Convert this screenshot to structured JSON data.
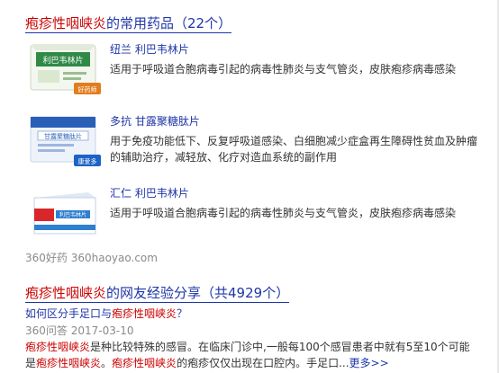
{
  "section1": {
    "title_highlight": "疱疹性咽峡炎",
    "title_rest": "的常用药品（22个）"
  },
  "drugs": [
    {
      "name": "纽兰 利巴韦林片",
      "desc": "适用于呼吸道合胞病毒引起的病毒性肺炎与支气管炎，皮肤疱疹病毒感染",
      "package_text": "利巴韦林片",
      "package_badge": "好药师",
      "icon": "drug-box-green"
    },
    {
      "name": "多抗 甘露聚糖肽片",
      "desc": "用于免疫功能低下、反复呼吸道感染、白细胞减少症盒再生障碍性贫血及肿瘤的辅助治疗，减轻放、化疗对造血系统的副作用",
      "package_text": "甘露聚糖肽片",
      "package_badge": "康爱多",
      "icon": "drug-box-blue"
    },
    {
      "name": "汇仁 利巴韦林片",
      "desc": "适用于呼吸道合胞病毒引起的病毒性肺炎与支气管炎，皮肤疱疹病毒感染",
      "package_text": "利巴韦林片",
      "package_badge": "",
      "icon": "drug-box-white"
    }
  ],
  "source": "360好药 360haoyao.com",
  "section2": {
    "title_highlight": "疱疹性咽峡炎",
    "title_rest": "的网友经验分享（共4929个）"
  },
  "question": {
    "prefix": "如何区分手足口与",
    "highlight": "疱疹性咽峡炎",
    "suffix": "？",
    "meta": "360问答   2017-03-10",
    "body_hl1": "疱疹性咽峡炎",
    "body_1": "是种比较特殊的感冒。在临床门诊中,一般每100个感冒患者中就有5至10个可能是",
    "body_hl2": "疱疹性咽峡炎",
    "body_2": "。",
    "body_hl3": "疱疹性咽峡炎",
    "body_3": "的疱疹仅仅出现在口腔内。手足口...",
    "more": "更多>>"
  },
  "colors": {
    "link": "#1f36a8",
    "highlight": "#cc0000",
    "meta": "#8a8a8a"
  }
}
